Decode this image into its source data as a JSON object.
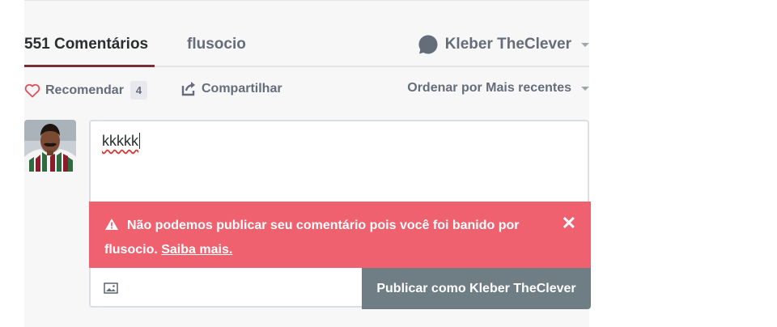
{
  "tabs": {
    "comments_count_label": "551 Comentários",
    "forum_label": "flusocio",
    "user_name": "Kleber TheClever"
  },
  "actions": {
    "recommend_label": "Recomendar",
    "recommend_count": "4",
    "share_label": "Compartilhar",
    "sort_label": "Ordenar por Mais recentes"
  },
  "composer": {
    "text": "kkkkk",
    "alert_message": "Não podemos publicar seu comentário pois você foi banido por flusocio.",
    "alert_link": "Saiba mais.",
    "close_glyph": "✕",
    "submit_label": "Publicar como Kleber TheClever"
  },
  "colors": {
    "accent_underline": "#7b2d35",
    "alert_bg": "#f0616f",
    "submit_bg": "#6f7e84",
    "muted_text": "#656c7a"
  },
  "icons": {
    "user": "chat-bubble-icon",
    "recommend": "heart-icon",
    "share": "share-icon",
    "alert": "warning-icon",
    "attach": "image-icon"
  }
}
